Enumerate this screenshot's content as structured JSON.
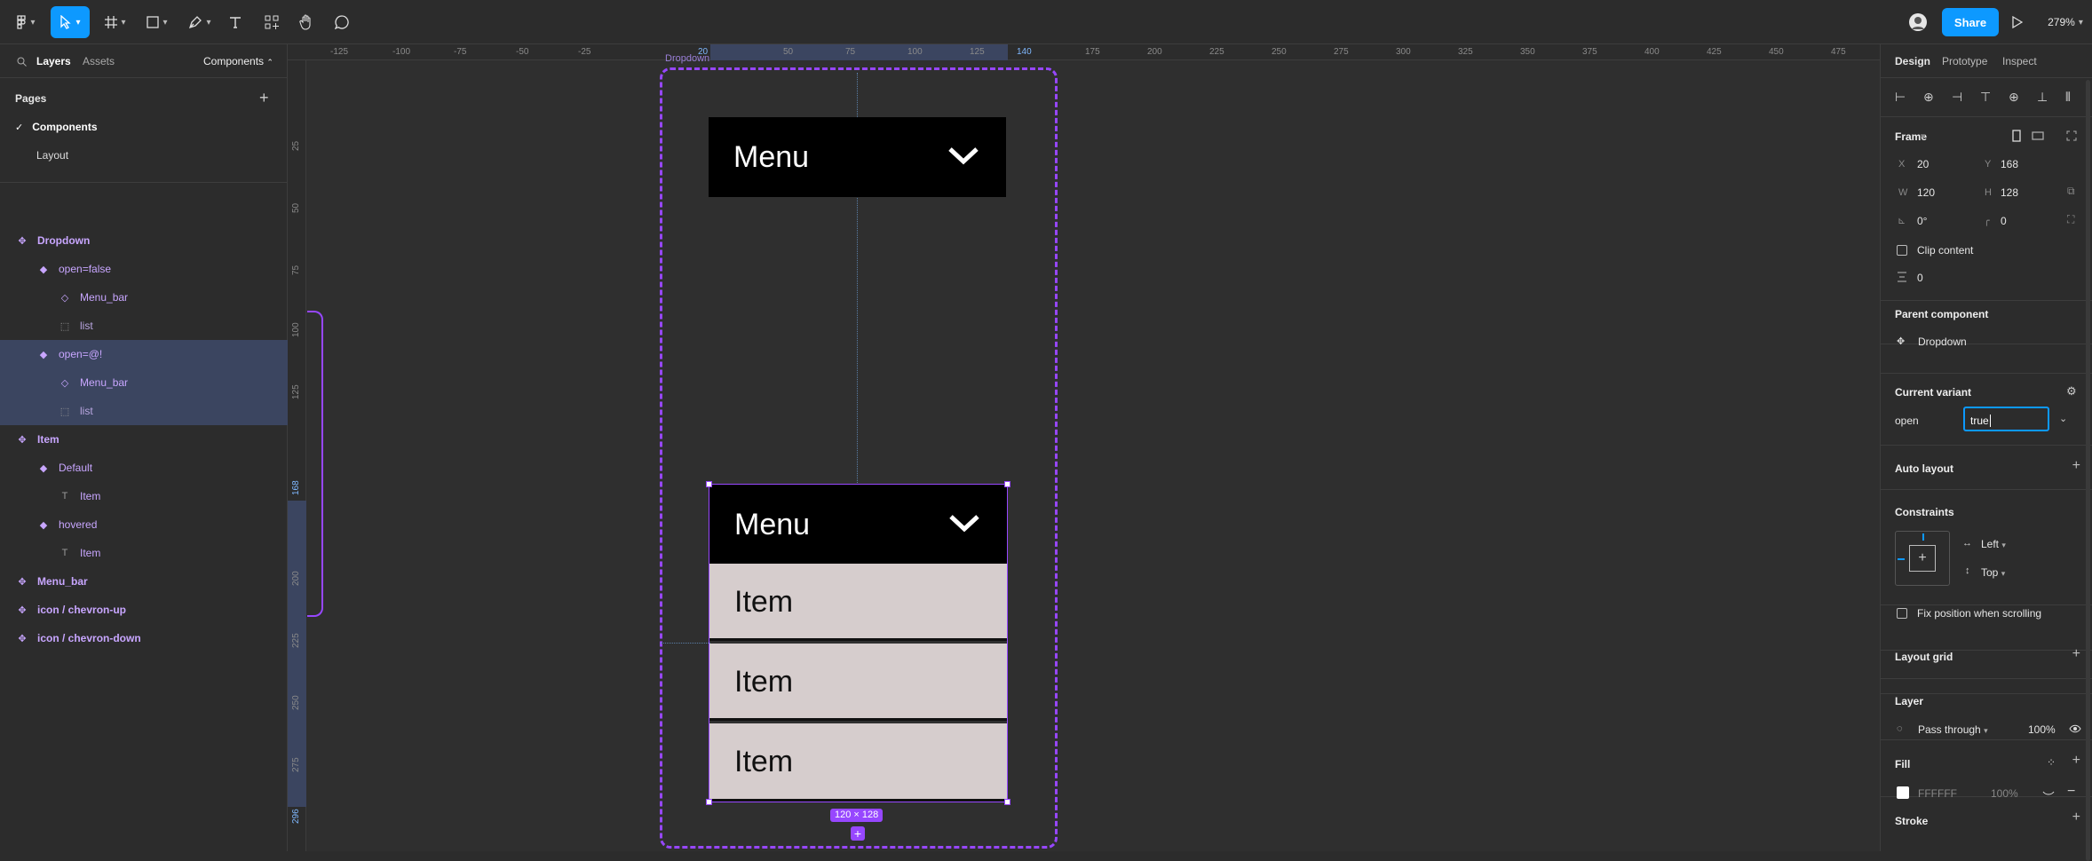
{
  "toolbar": {
    "share_label": "Share",
    "zoom": "279%"
  },
  "left_panel": {
    "tabs": {
      "layers": "Layers",
      "assets": "Assets",
      "components": "Components"
    },
    "pages_title": "Pages",
    "pages": [
      "Components",
      "Layout"
    ],
    "layers": [
      {
        "label": "Dropdown",
        "icon": "component-icon",
        "indent": 0,
        "selected": false
      },
      {
        "label": "open=false",
        "icon": "variant-icon",
        "indent": 1,
        "selected": false
      },
      {
        "label": "Menu_bar",
        "icon": "instance-icon",
        "indent": 2,
        "selected": false
      },
      {
        "label": "list",
        "icon": "frame-icon",
        "indent": 2,
        "selected": false
      },
      {
        "label": "open=@!",
        "icon": "variant-icon",
        "indent": 1,
        "selected": true
      },
      {
        "label": "Menu_bar",
        "icon": "instance-icon",
        "indent": 2,
        "selected": true
      },
      {
        "label": "list",
        "icon": "frame-icon",
        "indent": 2,
        "selected": true
      },
      {
        "label": "Item",
        "icon": "component-icon",
        "indent": 0,
        "selected": false
      },
      {
        "label": "Default",
        "icon": "variant-icon",
        "indent": 1,
        "selected": false
      },
      {
        "label": "Item",
        "icon": "text-icon",
        "indent": 2,
        "selected": false
      },
      {
        "label": "hovered",
        "icon": "variant-icon",
        "indent": 1,
        "selected": false
      },
      {
        "label": "Item",
        "icon": "text-icon",
        "indent": 2,
        "selected": false
      },
      {
        "label": "Menu_bar",
        "icon": "component-icon",
        "indent": 0,
        "selected": false
      },
      {
        "label": "icon / chevron-up",
        "icon": "component-icon",
        "indent": 0,
        "selected": false
      },
      {
        "label": "icon / chevron-down",
        "icon": "component-icon",
        "indent": 0,
        "selected": false
      }
    ]
  },
  "canvas": {
    "ruler_top": [
      "-125",
      "-100",
      "-75",
      "-50",
      "-25",
      "20",
      "50",
      "75",
      "100",
      "125",
      "140",
      "175",
      "200",
      "225",
      "250",
      "275",
      "300",
      "325",
      "350",
      "375",
      "400",
      "425",
      "450",
      "475"
    ],
    "ruler_left": [
      "25",
      "50",
      "75",
      "100",
      "125",
      "168",
      "200",
      "225",
      "250",
      "275",
      "296"
    ],
    "frame_label": "Dropdown",
    "menu_top_label": "Menu",
    "menu_bottom_label": "Menu",
    "items": [
      "Item",
      "Item",
      "Item"
    ],
    "size_badge": "120 × 128"
  },
  "right_panel": {
    "tabs": {
      "design": "Design",
      "prototype": "Prototype",
      "inspect": "Inspect"
    },
    "frame_title": "Frame",
    "x_label": "X",
    "x": "20",
    "y_label": "Y",
    "y": "168",
    "w_label": "W",
    "w": "120",
    "h_label": "H",
    "h": "128",
    "rotation": "0°",
    "radius": "0",
    "clip_content": "Clip content",
    "spacing": "0",
    "parent_component_title": "Parent component",
    "parent_component": "Dropdown",
    "current_variant_title": "Current variant",
    "variant_prop": "open",
    "variant_value": "true",
    "auto_layout": "Auto layout",
    "constraints": "Constraints",
    "constraint_h": "Left",
    "constraint_v": "Top",
    "fix_position": "Fix position when scrolling",
    "layout_grid": "Layout grid",
    "layer_title": "Layer",
    "blend": "Pass through",
    "opacity": "100%",
    "fill_title": "Fill",
    "fill_hex": "FFFFFF",
    "fill_opacity": "100%",
    "stroke_title": "Stroke"
  },
  "colors": {
    "accent": "#0d99ff",
    "component": "#c8a6ff",
    "selection": "#9747ff"
  }
}
